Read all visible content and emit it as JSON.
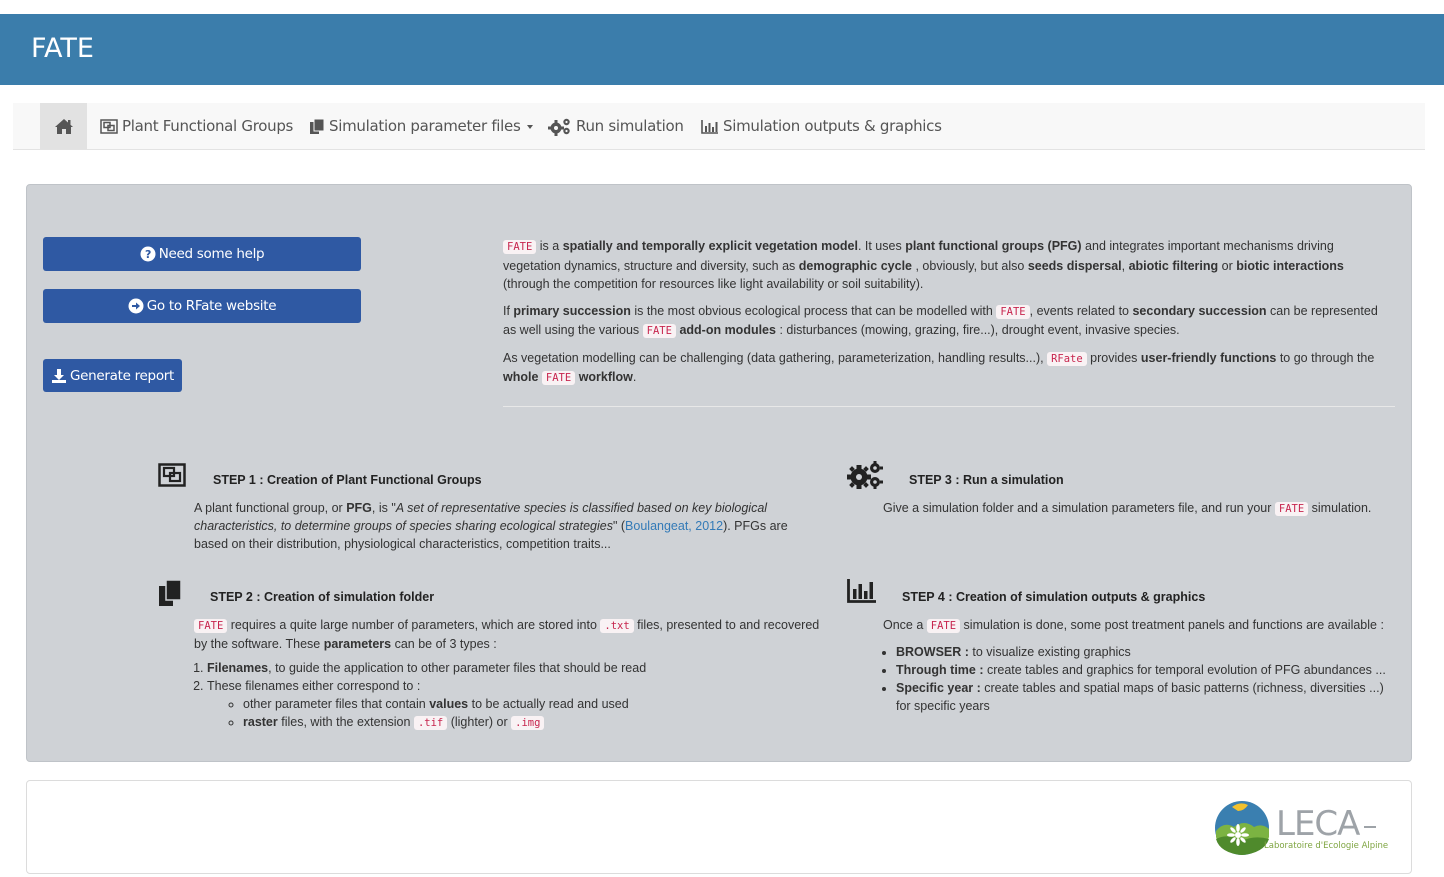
{
  "app": {
    "title": "FATE"
  },
  "nav": {
    "items": [
      {
        "label": "Plant Functional Groups"
      },
      {
        "label": "Simulation parameter files"
      },
      {
        "label": "Run simulation"
      },
      {
        "label": "Simulation outputs & graphics"
      }
    ]
  },
  "buttons": {
    "help": "Need some help",
    "rfate": "Go to RFate website",
    "report": "Generate report"
  },
  "intro": {
    "p1": {
      "tag": "FATE",
      "t1": " is a ",
      "b1": "spatially and temporally explicit vegetation model",
      "t2": ". It uses ",
      "b2": "plant functional groups (PFG)",
      "t3": " and integrates important mechanisms driving vegetation dynamics, structure and diversity, such as ",
      "b3": "demographic cycle",
      "t4": " , obviously, but also ",
      "b4": "seeds dispersal",
      "t5": ", ",
      "b5": "abiotic filtering",
      "t6": " or ",
      "b6": "biotic interactions",
      "t7": " (through the competition for resources like light availability or soil suitability)."
    },
    "p2": {
      "t1": "If ",
      "b1": "primary succession",
      "t2": " is the most obvious ecological process that can be modelled with ",
      "tag1": "FATE",
      "t3": ", events related to ",
      "b2": "secondary succession",
      "t4": " can be represented as well using the various ",
      "tag2": "FATE",
      "t5": " ",
      "b3": "add-on modules",
      "t6": " : disturbances (mowing, grazing, fire...), drought event, invasive species."
    },
    "p3": {
      "t1": "As vegetation modelling can be challenging (data gathering, parameterization, handling results...), ",
      "tag1": "RFate",
      "t2": " provides ",
      "b1": "user-friendly functions",
      "t3": " to go through the ",
      "b2": "whole",
      "t4": " ",
      "tag2": "FATE",
      "t5": " ",
      "b3": "workflow",
      "t6": "."
    }
  },
  "steps": {
    "s1": {
      "title": "STEP 1 : Creation of Plant Functional Groups",
      "t1": "A plant functional group, or ",
      "b1": "PFG",
      "t2": ", is \"",
      "i1": "A set of representative species is classified based on key biological characteristics, to determine groups of species sharing ecological strategies",
      "t3": "\" (",
      "link": "Boulangeat, 2012",
      "t4": "). PFGs are based on their distribution, physiological characteristics, competition traits..."
    },
    "s2": {
      "title": "STEP 2 : Creation of simulation folder",
      "tag1": "FATE",
      "t1": " requires a quite large number of parameters, which are stored into ",
      "tag2": ".txt",
      "t2": " files, presented to and recovered by the software. These ",
      "b1": "parameters",
      "t3": " can be of 3 types :",
      "li1_b": "Filenames",
      "li1_t": ", to guide the application to other parameter files that should be read",
      "li2_t": "These filenames either correspond to :",
      "sub1_t1": "other parameter files that contain ",
      "sub1_b": "values",
      "sub1_t2": " to be actually read and used",
      "sub2_b": "raster",
      "sub2_t1": " files, with the extension ",
      "sub2_tag1": ".tif",
      "sub2_t2": " (lighter) or ",
      "sub2_tag2": ".img"
    },
    "s3": {
      "title": "STEP 3 : Run a simulation",
      "t1": "Give a simulation folder and a simulation parameters file, and run your ",
      "tag1": "FATE",
      "t2": " simulation."
    },
    "s4": {
      "title": "STEP 4 : Creation of simulation outputs & graphics",
      "t1": "Once a ",
      "tag1": "FATE",
      "t2": " simulation is done, some post treatment panels and functions are available :",
      "li1_b": "BROWSER :",
      "li1_t": " to visualize existing graphics",
      "li2_b": "Through time :",
      "li2_t": " create tables and graphics for temporal evolution of PFG abundances ...",
      "li3_b": "Specific year :",
      "li3_t": " create tables and spatial maps of basic patterns (richness, diversities ...) for specific years"
    }
  },
  "footer": {
    "logo_text": "LECA",
    "logo_subtitle": "Laboratoire d'Ecologie Alpine"
  },
  "colors": {
    "header": "#3b7dab",
    "button": "#2f59a3",
    "panel": "#cfd2d6",
    "code": "#c7254e"
  }
}
